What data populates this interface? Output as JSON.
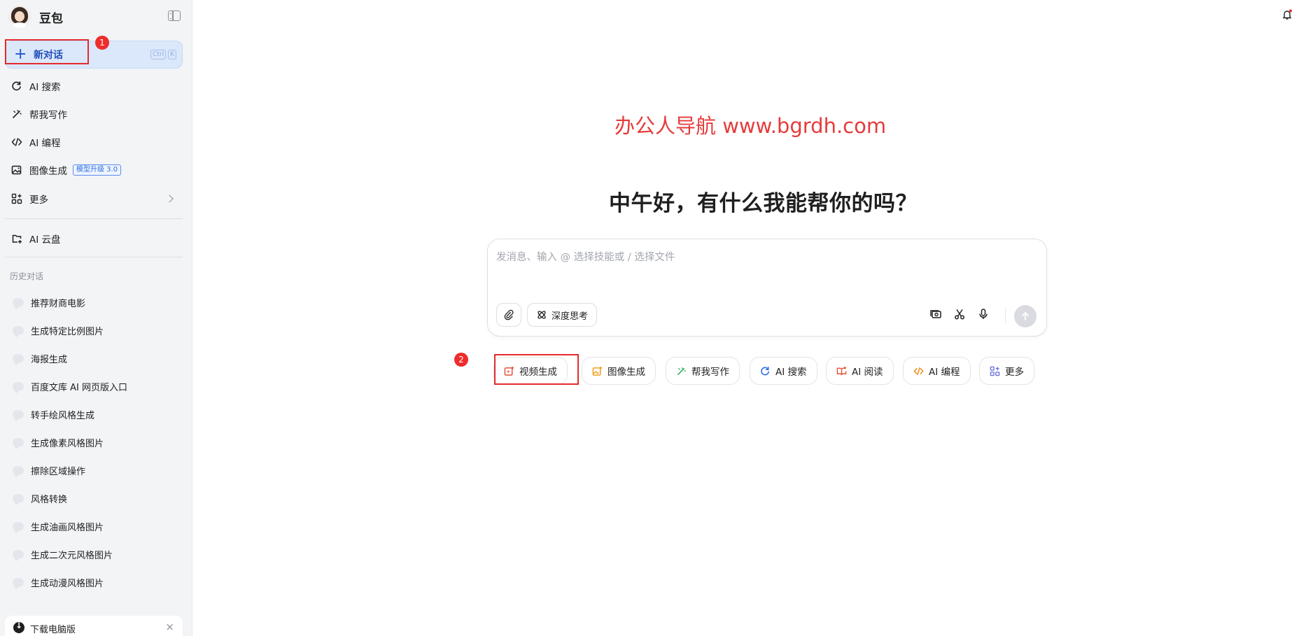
{
  "sidebar": {
    "brand_name": "豆包",
    "new_chat": {
      "label": "新对话",
      "shortcut_keys": [
        "Ctrl",
        "K"
      ]
    },
    "nav_items": [
      {
        "label": "AI 搜索",
        "icon": "search-refresh-icon"
      },
      {
        "label": "帮我写作",
        "icon": "pen-icon"
      },
      {
        "label": "AI 编程",
        "icon": "code-icon"
      },
      {
        "label": "图像生成",
        "icon": "image-icon",
        "tag": "模型升级 3.0"
      },
      {
        "label": "更多",
        "icon": "grid-plus-icon"
      }
    ],
    "cloud_item": {
      "label": "AI 云盘",
      "icon": "cloud-drive-icon"
    },
    "history_title": "历史对话",
    "history": [
      "推荐财商电影",
      "生成特定比例图片",
      "海报生成",
      "百度文库 AI 网页版入口",
      "转手绘风格生成",
      "生成像素风格图片",
      "擦除区域操作",
      "风格转换",
      "生成油画风格图片",
      "生成二次元风格图片",
      "生成动漫风格图片"
    ],
    "download": {
      "label": "下载电脑版",
      "close": "×"
    }
  },
  "annotations": {
    "badge1": "1",
    "badge2": "2"
  },
  "main": {
    "watermark": "办公人导航 www.bgrdh.com",
    "greeting": "中午好，有什么我能帮你的吗？",
    "composer": {
      "placeholder": "发消息、输入 @ 选择技能或 / 选择文件",
      "deep_think_label": "深度思考"
    },
    "chips": [
      {
        "label": "视频生成",
        "icon": "video-plus-icon",
        "color": "#e5533b"
      },
      {
        "label": "图像生成",
        "icon": "image-icon",
        "color": "#f0a020"
      },
      {
        "label": "帮我写作",
        "icon": "pen-icon",
        "color": "#2fb36a"
      },
      {
        "label": "AI 搜索",
        "icon": "search-refresh-icon",
        "color": "#2f6fe4"
      },
      {
        "label": "AI 阅读",
        "icon": "book-icon",
        "color": "#e5533b"
      },
      {
        "label": "AI 编程",
        "icon": "code-icon",
        "color": "#f08b1a"
      },
      {
        "label": "更多",
        "icon": "grid-plus-icon",
        "color": "#6a74d8"
      }
    ]
  },
  "colors": {
    "accent": "#1f55c9",
    "annotation_red": "#e52b2b",
    "sidebar_bg": "#f3f4f6"
  }
}
